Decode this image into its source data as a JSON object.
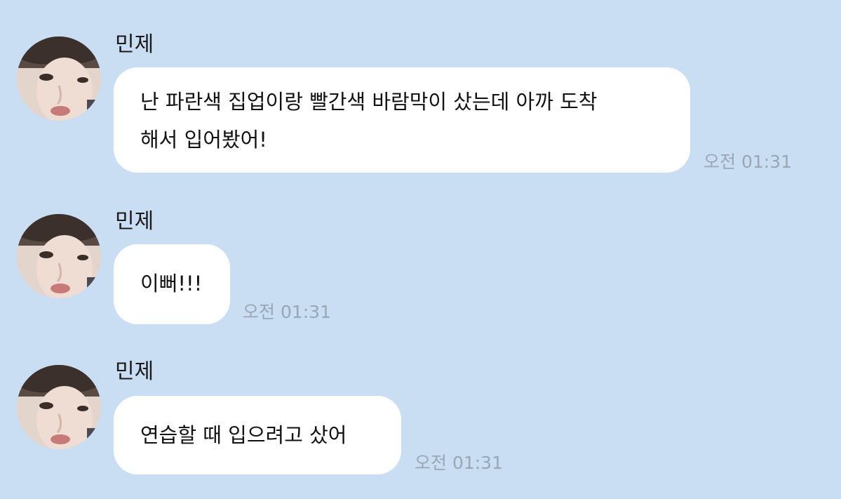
{
  "messages": [
    {
      "sender": "민제",
      "lines": [
        "난 파란색 집업이랑 빨간색 바람막이 샀는데 아까 도착",
        "해서 입어봤어!"
      ],
      "time": "오전 01:31"
    },
    {
      "sender": "민제",
      "lines": [
        "이뻐!!!"
      ],
      "time": "오전 01:31"
    },
    {
      "sender": "민제",
      "lines": [
        "연습할 때 입으려고 샀어"
      ],
      "time": "오전 01:31"
    }
  ],
  "colors": {
    "background": "#cadef3",
    "bubble": "#ffffff",
    "timestamp": "#9aa6b4"
  },
  "icons": {
    "avatar": "profile-photo-avatar"
  }
}
